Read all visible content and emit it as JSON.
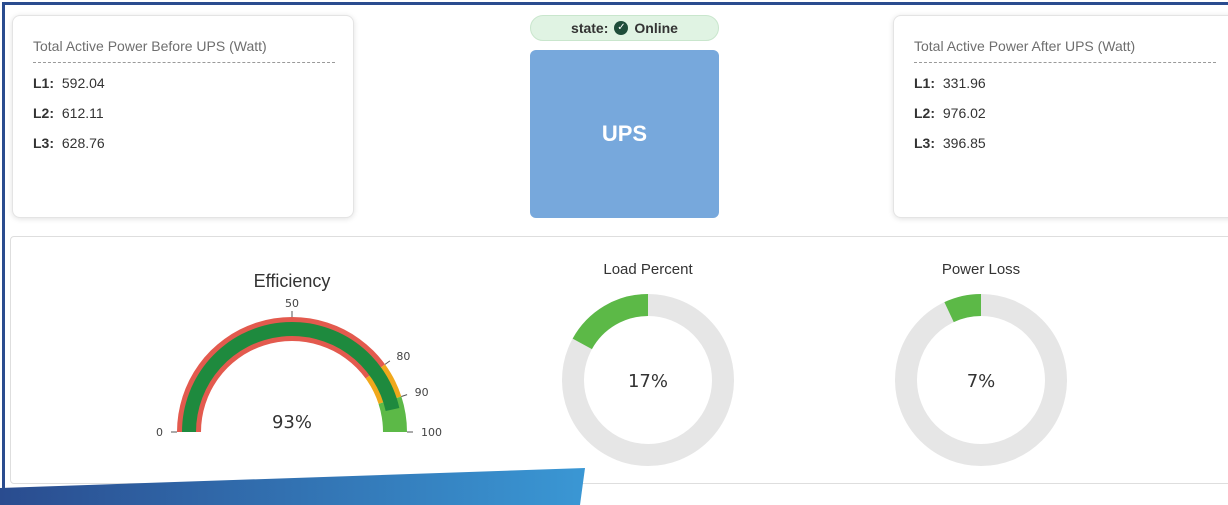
{
  "before_card": {
    "title": "Total Active Power Before UPS (Watt)",
    "lines": [
      {
        "label": "L1:",
        "value": "592.04"
      },
      {
        "label": "L2:",
        "value": "612.11"
      },
      {
        "label": "L3:",
        "value": "628.76"
      }
    ]
  },
  "after_card": {
    "title": "Total Active Power After UPS (Watt)",
    "lines": [
      {
        "label": "L1:",
        "value": "331.96"
      },
      {
        "label": "L2:",
        "value": "976.02"
      },
      {
        "label": "L3:",
        "value": "396.85"
      }
    ]
  },
  "state": {
    "label": "state:",
    "value": "Online",
    "icon": "check-circle-icon"
  },
  "ups": {
    "label": "UPS"
  },
  "efficiency": {
    "title": "Efficiency",
    "value": 93,
    "value_label": "93%",
    "ticks": [
      "0",
      "50",
      "80",
      "90",
      "100"
    ]
  },
  "load_percent": {
    "title": "Load Percent",
    "value": 17,
    "value_label": "17%"
  },
  "power_loss": {
    "title": "Power Loss",
    "value": 7,
    "value_label": "7%"
  },
  "colors": {
    "green": "#5cb947",
    "dark_green": "#1e8a3e",
    "red": "#e35a4e",
    "orange": "#f0a81c",
    "track": "#e6e6e6",
    "ups_blue": "#77a8dc",
    "frame_blue": "#2a4c8f"
  }
}
